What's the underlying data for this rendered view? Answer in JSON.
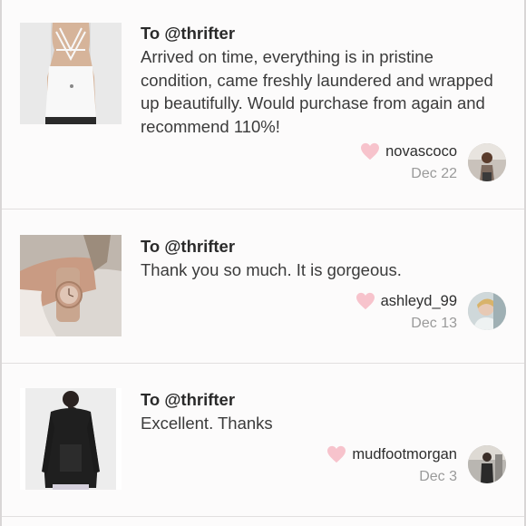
{
  "reviews": [
    {
      "to": "To @thrifter",
      "message": "Arrived on time, everything is in pristine condition, came freshly laundered and wrapped up beautifully. Would purchase from again and recommend 110%!",
      "username": "novascoco",
      "date": "Dec 22",
      "icon": "heart-icon"
    },
    {
      "to": "To @thrifter",
      "message": "Thank you so much. It is gorgeous.",
      "username": "ashleyd_99",
      "date": "Dec 13",
      "icon": "heart-icon"
    },
    {
      "to": "To @thrifter",
      "message": "Excellent. Thanks",
      "username": "mudfootmorgan",
      "date": "Dec 3",
      "icon": "heart-icon"
    }
  ],
  "colors": {
    "heart": "#f7c3cc",
    "background": "#fcfbfb",
    "divider": "#e2dfdf"
  }
}
